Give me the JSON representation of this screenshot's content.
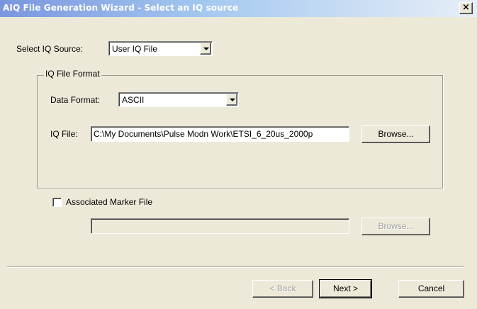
{
  "window": {
    "title": "AIQ File Generation Wizard - Select an IQ source",
    "close_glyph": "×"
  },
  "source": {
    "label": "Select IQ Source:",
    "selected": "User IQ File"
  },
  "format_group": {
    "title": "IQ File Format",
    "data_format_label": "Data Format:",
    "data_format_selected": "ASCII",
    "iq_file_label": "IQ File:",
    "iq_file_value": "C:\\My Documents\\Pulse Modn Work\\ETSI_6_20us_2000p",
    "browse_label": "Browse..."
  },
  "marker": {
    "checkbox_label": "Associated Marker File",
    "checked": false,
    "file_value": "",
    "browse_label": "Browse..."
  },
  "footer": {
    "back_label": "< Back",
    "next_label": "Next >",
    "cancel_label": "Cancel"
  },
  "icons": {
    "close": "close-icon",
    "dropdown": "chevron-down-icon"
  },
  "colors": {
    "dialog_bg": "#ece9d8",
    "titlebar_start": "#7a96df",
    "titlebar_end": "#e8eef8",
    "title_text": "#ffffff",
    "disabled_text": "#a0a0a0"
  }
}
